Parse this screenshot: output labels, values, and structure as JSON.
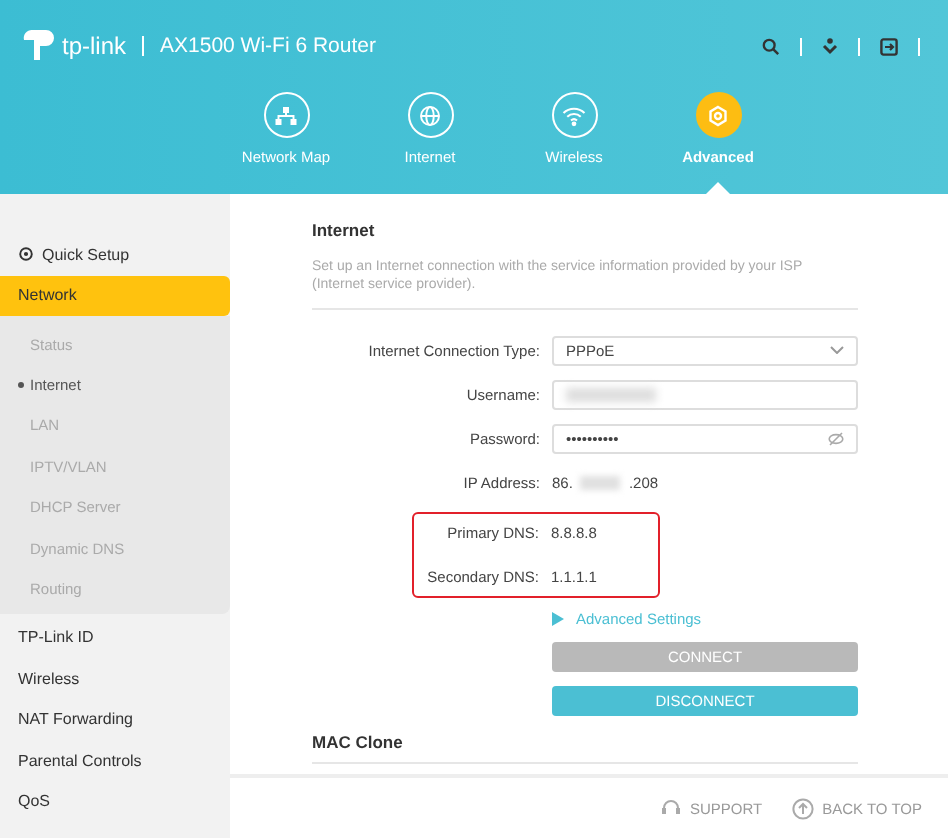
{
  "header": {
    "brand": "tp-link",
    "model": "AX1500 Wi-Fi 6 Router"
  },
  "nav": [
    {
      "label": "Network Map",
      "selected": false
    },
    {
      "label": "Internet",
      "selected": false
    },
    {
      "label": "Wireless",
      "selected": false
    },
    {
      "label": "Advanced",
      "selected": true
    }
  ],
  "sidebar": {
    "items": [
      {
        "label": "Quick Setup",
        "kind": "setup",
        "selected": false
      },
      {
        "label": "Network",
        "kind": "group",
        "selected": true,
        "children": [
          {
            "label": "Status",
            "selected": false
          },
          {
            "label": "Internet",
            "selected": true
          },
          {
            "label": "LAN",
            "selected": false
          },
          {
            "label": "IPTV/VLAN",
            "selected": false
          },
          {
            "label": "DHCP Server",
            "selected": false
          },
          {
            "label": "Dynamic DNS",
            "selected": false
          },
          {
            "label": "Routing",
            "selected": false
          }
        ]
      },
      {
        "label": "TP-Link ID",
        "kind": "group",
        "selected": false
      },
      {
        "label": "Wireless",
        "kind": "group",
        "selected": false
      },
      {
        "label": "NAT Forwarding",
        "kind": "group",
        "selected": false
      },
      {
        "label": "Parental Controls",
        "kind": "group",
        "selected": false
      },
      {
        "label": "QoS",
        "kind": "group",
        "selected": false
      }
    ]
  },
  "section": {
    "title": "Internet",
    "description": "Set up an Internet connection with the service information provided by your ISP (Internet service provider).",
    "fields": [
      {
        "label": "Internet Connection Type:",
        "kind": "select",
        "value": "PPPoE"
      },
      {
        "label": "Username:",
        "kind": "blurred"
      },
      {
        "label": "Password:",
        "kind": "password",
        "value": "••••••••••"
      },
      {
        "label": "IP Address:",
        "kind": "ip",
        "value": "86.",
        "value_end": ".208"
      },
      {
        "label": "Primary DNS:",
        "kind": "text",
        "value": "8.8.8.8",
        "highlighted": true
      },
      {
        "label": "Secondary DNS:",
        "kind": "text",
        "value": "1.1.1.1",
        "highlighted": true
      }
    ],
    "advanced_link": "Advanced Settings",
    "buttons": [
      {
        "label": "CONNECT",
        "disabled": true
      },
      {
        "label": "DISCONNECT",
        "disabled": false
      }
    ]
  },
  "next_section": {
    "title": "MAC Clone"
  },
  "footer": {
    "support": "SUPPORT",
    "back_to_top": "BACK TO TOP"
  }
}
